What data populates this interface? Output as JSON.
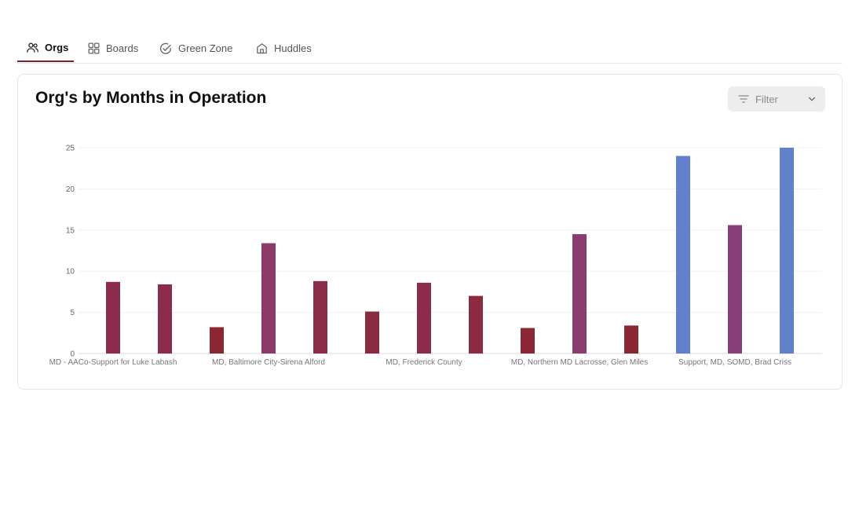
{
  "tabs": [
    {
      "label": "Orgs",
      "icon": "users-icon",
      "active": true
    },
    {
      "label": "Boards",
      "icon": "grid-icon",
      "active": false
    },
    {
      "label": "Green Zone",
      "icon": "check-circle-icon",
      "active": false
    },
    {
      "label": "Huddles",
      "icon": "home-icon",
      "active": false
    }
  ],
  "card": {
    "title": "Org's by Months in Operation"
  },
  "filter": {
    "label": "Filter",
    "icon": "filter-lines-icon",
    "chevron": "chevron-down-icon"
  },
  "colors": {
    "accent": "#7d2330",
    "bar_red": "#8b2a33",
    "bar_wine": "#8a2f4c",
    "bar_magenta": "#8c3a6a",
    "bar_purple": "#873f78",
    "bar_blue": "#6280cc"
  },
  "chart_data": {
    "type": "bar",
    "ylim": [
      0,
      25
    ],
    "yticks": [
      0,
      5,
      10,
      15,
      20,
      25
    ],
    "grid": true,
    "visible_category_labels": [
      "MD - AACo-Support for Luke Labash",
      "MD, Baltimore City-Sirena Alford",
      "MD, Frederick County",
      "MD, Northern MD Lacrosse, Glen Miles",
      "Support, MD, SOMD, Brad Criss"
    ],
    "values": [
      8.7,
      8.4,
      3.2,
      13.4,
      8.8,
      5.1,
      8.6,
      7.0,
      3.1,
      14.5,
      3.4,
      24.0,
      15.6,
      25.0
    ],
    "bar_colors": [
      "#8b2d4a",
      "#8b2d4a",
      "#8a2732",
      "#8c3a6a",
      "#8b2d4a",
      "#8a2a3e",
      "#8b2d4a",
      "#8a2b40",
      "#8a2732",
      "#8c3d70",
      "#8a2732",
      "#6280cc",
      "#873f78",
      "#6280cc"
    ]
  }
}
